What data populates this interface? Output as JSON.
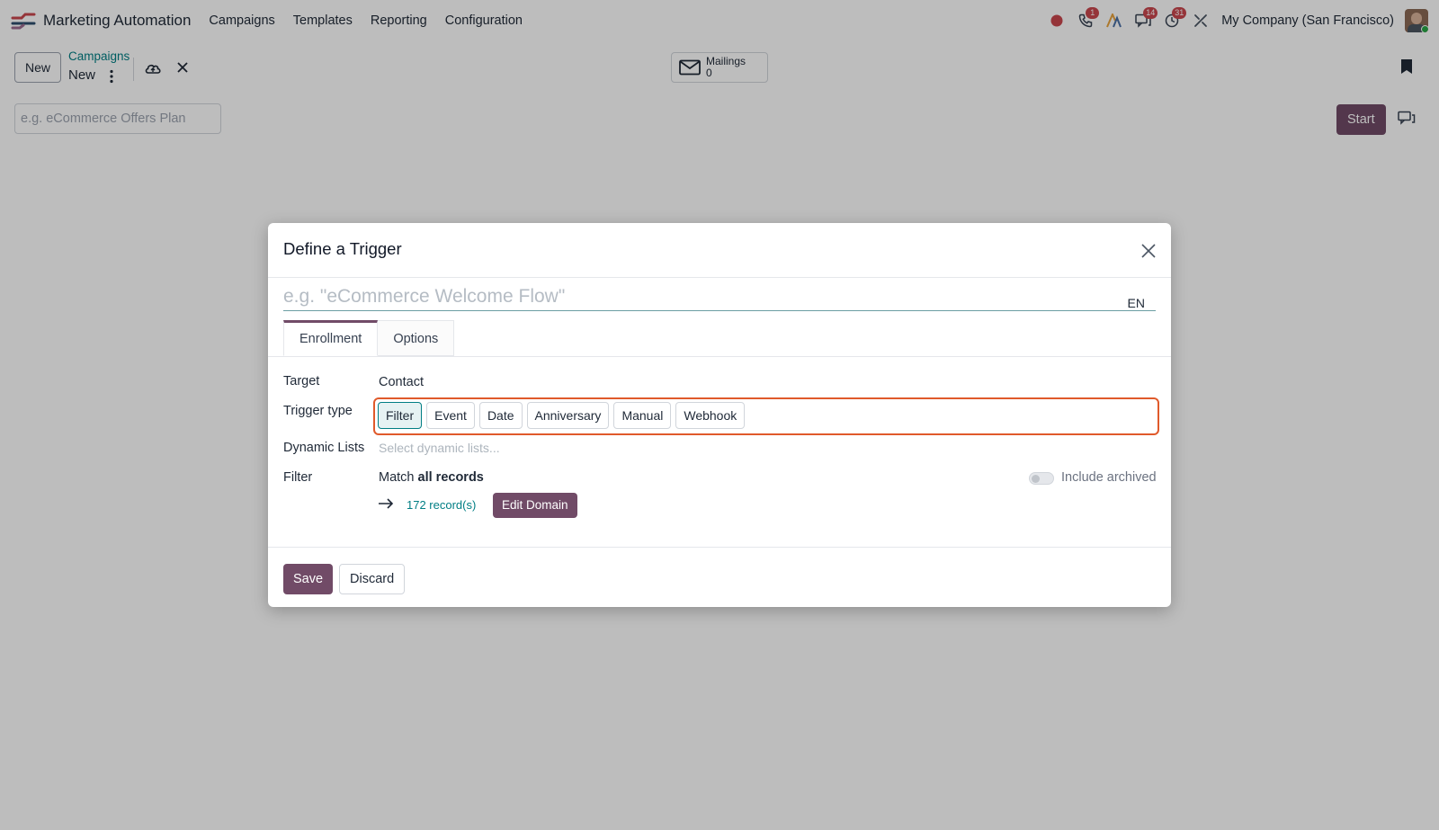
{
  "navbar": {
    "app_name": "Marketing Automation",
    "menu": [
      "Campaigns",
      "Templates",
      "Reporting",
      "Configuration"
    ],
    "badges": {
      "calls": "1",
      "messages": "14",
      "activities": "31"
    },
    "company": "My Company (San Francisco)"
  },
  "control_panel": {
    "new_label": "New",
    "breadcrumb": "Campaigns",
    "record_name": "New",
    "smart_button": {
      "label": "Mailings",
      "count": "0"
    }
  },
  "form": {
    "name_placeholder": "e.g. eCommerce Offers Plan",
    "start_label": "Start"
  },
  "dialog": {
    "title": "Define a Trigger",
    "name_placeholder": "e.g. \"eCommerce Welcome Flow\"",
    "language": "EN",
    "tabs": [
      "Enrollment",
      "Options"
    ],
    "fields": {
      "target_label": "Target",
      "target_value": "Contact",
      "trigger_type_label": "Trigger type",
      "trigger_types": [
        "Filter",
        "Event",
        "Date",
        "Anniversary",
        "Manual",
        "Webhook"
      ],
      "trigger_type_selected": "Filter",
      "dynamic_lists_label": "Dynamic Lists",
      "dynamic_lists_placeholder": "Select dynamic lists...",
      "filter_label": "Filter",
      "match_prefix": "Match",
      "match_bold": "all records",
      "include_archived_label": "Include archived",
      "include_archived": false,
      "records_count": "172 record(s)",
      "edit_domain_label": "Edit Domain"
    },
    "footer": {
      "save_label": "Save",
      "discard_label": "Discard"
    }
  },
  "colors": {
    "brand": "#714b67",
    "link": "#017e84",
    "highlight": "#e05a2b",
    "badge": "#c9474e"
  }
}
